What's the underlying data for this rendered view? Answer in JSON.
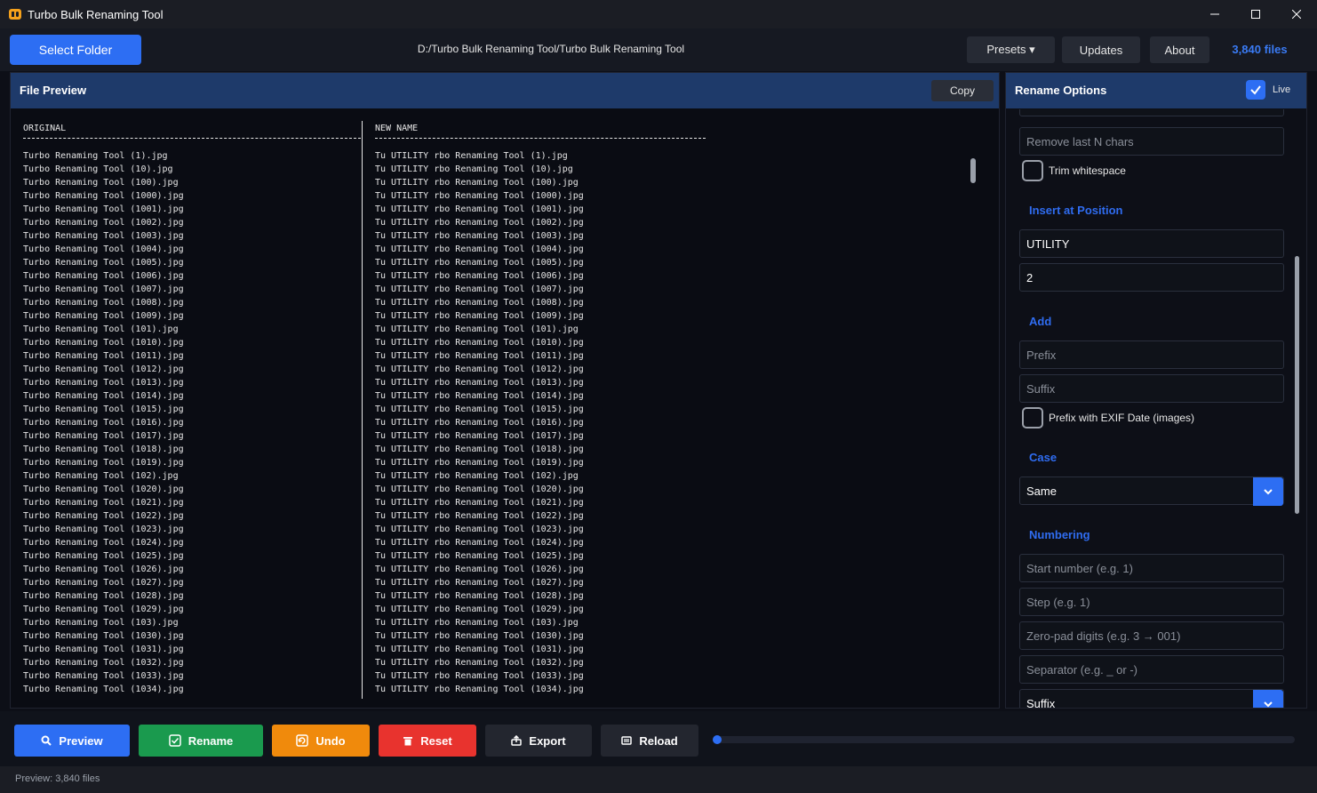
{
  "window": {
    "title": "Turbo Bulk Renaming Tool",
    "accent": "#2d6ef3"
  },
  "topbar": {
    "select_folder": "Select Folder",
    "path": "D:/Turbo Bulk Renaming Tool/Turbo Bulk Renaming Tool",
    "presets": "Presets ▾",
    "updates": "Updates",
    "about": "About",
    "file_count": "3,840 files"
  },
  "preview": {
    "title": "File Preview",
    "copy": "Copy",
    "col_original": "ORIGINAL",
    "col_new": "NEW NAME",
    "original": [
      "Turbo Renaming Tool (1).jpg",
      "Turbo Renaming Tool (10).jpg",
      "Turbo Renaming Tool (100).jpg",
      "Turbo Renaming Tool (1000).jpg",
      "Turbo Renaming Tool (1001).jpg",
      "Turbo Renaming Tool (1002).jpg",
      "Turbo Renaming Tool (1003).jpg",
      "Turbo Renaming Tool (1004).jpg",
      "Turbo Renaming Tool (1005).jpg",
      "Turbo Renaming Tool (1006).jpg",
      "Turbo Renaming Tool (1007).jpg",
      "Turbo Renaming Tool (1008).jpg",
      "Turbo Renaming Tool (1009).jpg",
      "Turbo Renaming Tool (101).jpg",
      "Turbo Renaming Tool (1010).jpg",
      "Turbo Renaming Tool (1011).jpg",
      "Turbo Renaming Tool (1012).jpg",
      "Turbo Renaming Tool (1013).jpg",
      "Turbo Renaming Tool (1014).jpg",
      "Turbo Renaming Tool (1015).jpg",
      "Turbo Renaming Tool (1016).jpg",
      "Turbo Renaming Tool (1017).jpg",
      "Turbo Renaming Tool (1018).jpg",
      "Turbo Renaming Tool (1019).jpg",
      "Turbo Renaming Tool (102).jpg",
      "Turbo Renaming Tool (1020).jpg",
      "Turbo Renaming Tool (1021).jpg",
      "Turbo Renaming Tool (1022).jpg",
      "Turbo Renaming Tool (1023).jpg",
      "Turbo Renaming Tool (1024).jpg",
      "Turbo Renaming Tool (1025).jpg",
      "Turbo Renaming Tool (1026).jpg",
      "Turbo Renaming Tool (1027).jpg",
      "Turbo Renaming Tool (1028).jpg",
      "Turbo Renaming Tool (1029).jpg",
      "Turbo Renaming Tool (103).jpg",
      "Turbo Renaming Tool (1030).jpg",
      "Turbo Renaming Tool (1031).jpg",
      "Turbo Renaming Tool (1032).jpg",
      "Turbo Renaming Tool (1033).jpg",
      "Turbo Renaming Tool (1034).jpg"
    ],
    "renamed": [
      "Tu UTILITY rbo Renaming Tool (1).jpg",
      "Tu UTILITY rbo Renaming Tool (10).jpg",
      "Tu UTILITY rbo Renaming Tool (100).jpg",
      "Tu UTILITY rbo Renaming Tool (1000).jpg",
      "Tu UTILITY rbo Renaming Tool (1001).jpg",
      "Tu UTILITY rbo Renaming Tool (1002).jpg",
      "Tu UTILITY rbo Renaming Tool (1003).jpg",
      "Tu UTILITY rbo Renaming Tool (1004).jpg",
      "Tu UTILITY rbo Renaming Tool (1005).jpg",
      "Tu UTILITY rbo Renaming Tool (1006).jpg",
      "Tu UTILITY rbo Renaming Tool (1007).jpg",
      "Tu UTILITY rbo Renaming Tool (1008).jpg",
      "Tu UTILITY rbo Renaming Tool (1009).jpg",
      "Tu UTILITY rbo Renaming Tool (101).jpg",
      "Tu UTILITY rbo Renaming Tool (1010).jpg",
      "Tu UTILITY rbo Renaming Tool (1011).jpg",
      "Tu UTILITY rbo Renaming Tool (1012).jpg",
      "Tu UTILITY rbo Renaming Tool (1013).jpg",
      "Tu UTILITY rbo Renaming Tool (1014).jpg",
      "Tu UTILITY rbo Renaming Tool (1015).jpg",
      "Tu UTILITY rbo Renaming Tool (1016).jpg",
      "Tu UTILITY rbo Renaming Tool (1017).jpg",
      "Tu UTILITY rbo Renaming Tool (1018).jpg",
      "Tu UTILITY rbo Renaming Tool (1019).jpg",
      "Tu UTILITY rbo Renaming Tool (102).jpg",
      "Tu UTILITY rbo Renaming Tool (1020).jpg",
      "Tu UTILITY rbo Renaming Tool (1021).jpg",
      "Tu UTILITY rbo Renaming Tool (1022).jpg",
      "Tu UTILITY rbo Renaming Tool (1023).jpg",
      "Tu UTILITY rbo Renaming Tool (1024).jpg",
      "Tu UTILITY rbo Renaming Tool (1025).jpg",
      "Tu UTILITY rbo Renaming Tool (1026).jpg",
      "Tu UTILITY rbo Renaming Tool (1027).jpg",
      "Tu UTILITY rbo Renaming Tool (1028).jpg",
      "Tu UTILITY rbo Renaming Tool (1029).jpg",
      "Tu UTILITY rbo Renaming Tool (103).jpg",
      "Tu UTILITY rbo Renaming Tool (1030).jpg",
      "Tu UTILITY rbo Renaming Tool (1031).jpg",
      "Tu UTILITY rbo Renaming Tool (1032).jpg",
      "Tu UTILITY rbo Renaming Tool (1033).jpg",
      "Tu UTILITY rbo Renaming Tool (1034).jpg"
    ]
  },
  "options": {
    "title": "Rename Options",
    "live_label": "Live",
    "live_checked": true,
    "remove_last_placeholder": "Remove last N chars",
    "trim_whitespace": "Trim whitespace",
    "insert_section": "Insert at Position",
    "insert_text_value": "UTILITY",
    "insert_pos_value": "2",
    "add_section": "Add",
    "prefix_placeholder": "Prefix",
    "suffix_placeholder": "Suffix",
    "exif_prefix": "Prefix with EXIF Date (images)",
    "case_section": "Case",
    "case_value": "Same",
    "numbering_section": "Numbering",
    "start_placeholder": "Start number (e.g. 1)",
    "step_placeholder": "Step (e.g. 1)",
    "zeropad_placeholder": "Zero-pad digits (e.g. 3 → 001)",
    "separator_placeholder": "Separator (e.g. _ or -)",
    "number_position_value": "Suffix"
  },
  "actions": {
    "preview": "Preview",
    "rename": "Rename",
    "undo": "Undo",
    "reset": "Reset",
    "export": "Export",
    "reload": "Reload",
    "progress_fraction": 0,
    "colors": {
      "preview": "#2d6ef3",
      "rename": "#1a9a4e",
      "undo": "#f08a0c",
      "reset": "#e8332e",
      "neutral": "#23262f"
    }
  },
  "status": {
    "text": "Preview: 3,840 files"
  }
}
